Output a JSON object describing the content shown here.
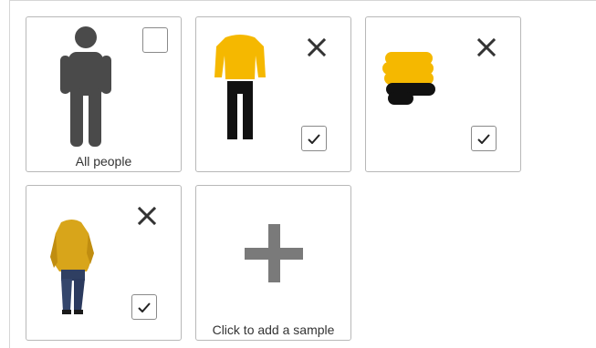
{
  "tiles": [
    {
      "id": "all-people",
      "caption": "All people",
      "checked": false,
      "removable": false
    },
    {
      "id": "sample-clothes-drawing",
      "caption": "",
      "checked": true,
      "removable": true
    },
    {
      "id": "sample-color-blob",
      "caption": "",
      "checked": true,
      "removable": true
    },
    {
      "id": "sample-person-photo",
      "caption": "",
      "checked": true,
      "removable": true
    }
  ],
  "add_tile": {
    "caption": "Click to add a sample"
  },
  "icons": {
    "person": "person-icon",
    "remove": "close-icon",
    "check": "check-icon",
    "add": "plus-icon"
  },
  "colors": {
    "yellow": "#f5b800",
    "black": "#111111",
    "icon_gray": "#4a4a4a",
    "plus_gray": "#7a7a7a"
  }
}
